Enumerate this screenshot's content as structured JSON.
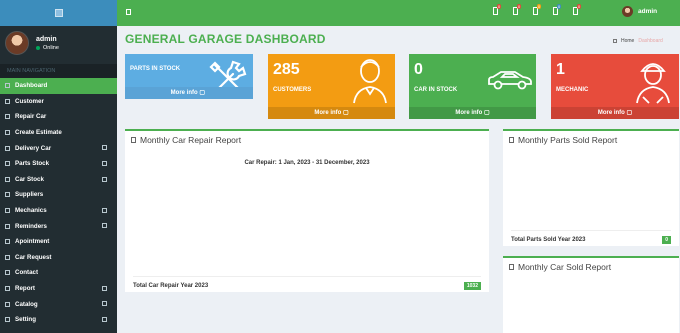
{
  "sidebar": {
    "user": {
      "name": "admin",
      "status": "Online"
    },
    "nav_header": "MAIN NAVIGATION",
    "items": [
      {
        "label": "Dashboard"
      },
      {
        "label": "Customer"
      },
      {
        "label": "Repair Car"
      },
      {
        "label": "Create Estimate"
      },
      {
        "label": "Delivery Car"
      },
      {
        "label": "Parts Stock"
      },
      {
        "label": "Car Stock"
      },
      {
        "label": "Suppliers"
      },
      {
        "label": "Mechanics"
      },
      {
        "label": "Reminders"
      },
      {
        "label": "Apointment"
      },
      {
        "label": "Car Request"
      },
      {
        "label": "Contact"
      },
      {
        "label": "Report"
      },
      {
        "label": "Catalog"
      },
      {
        "label": "Setting"
      }
    ]
  },
  "topbar": {
    "username": "admin",
    "badges": [
      "0",
      "0",
      "0",
      "0",
      "0"
    ],
    "badge_colors": [
      "#dd4b39",
      "#dd4b39",
      "#f39c12",
      "#3c8dbc",
      "#dd4b39"
    ]
  },
  "page": {
    "title": "GENERAL GARAGE DASHBOARD",
    "breadcrumb_home": "Home",
    "breadcrumb_current": "Dashboard"
  },
  "boxes": [
    {
      "value": "",
      "label": "PARTS IN STOCK",
      "more": "More info",
      "color": "#5dade2"
    },
    {
      "value": "285",
      "label": "CUSTOMERS",
      "more": "More info",
      "color": "#f39c12"
    },
    {
      "value": "0",
      "label": "CAR IN STOCK",
      "more": "More info",
      "color": "#4caf50"
    },
    {
      "value": "1",
      "label": "MECHANIC",
      "more": "More info",
      "color": "#e74c3c"
    }
  ],
  "panels": {
    "repair": {
      "title": "Monthly Car Repair Report",
      "subtitle": "Car Repair: 1 Jan, 2023 - 31 December, 2023",
      "footer_label": "Total Car Repair Year 2023",
      "footer_value": "1032"
    },
    "parts": {
      "title": "Monthly Parts Sold Report",
      "footer_label": "Total Parts Sold Year 2023",
      "footer_value": "0"
    },
    "cars": {
      "title": "Monthly Car Sold Report"
    }
  }
}
